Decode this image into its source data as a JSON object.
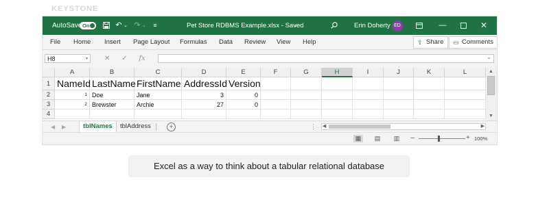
{
  "ghost_text": "KEYSTONE",
  "window": {
    "autosave_label": "AutoSave",
    "autosave_state": "On",
    "title": "Pet Store RDBMS Example.xlsx - Saved",
    "title_dropdown": "⌄",
    "user_name": "Erin Doherty",
    "user_initials": "ED",
    "accent_color": "#217346",
    "avatar_color": "#8a3ea8"
  },
  "menu": {
    "items": [
      "File",
      "Home",
      "Insert",
      "Page Layout",
      "Formulas",
      "Data",
      "Review",
      "View",
      "Help"
    ],
    "share_label": "Share",
    "comments_label": "Comments"
  },
  "formula": {
    "name_box": "H8",
    "value": ""
  },
  "columns": [
    "A",
    "B",
    "C",
    "D",
    "E",
    "F",
    "G",
    "H",
    "I",
    "J",
    "K",
    "L"
  ],
  "selected_column": "H",
  "rows": [
    {
      "n": "1",
      "a": "NameId",
      "b": "LastName",
      "c": "FirstName",
      "d": "AddressId",
      "e": "Version"
    },
    {
      "n": "2",
      "a": "1",
      "b": "Doe",
      "c": "Jane",
      "d": "3",
      "e": "0"
    },
    {
      "n": "3",
      "a": "2",
      "b": "Brewster",
      "c": "Archie",
      "d": "27",
      "e": "0"
    },
    {
      "n": "4",
      "a": "",
      "b": "",
      "c": "",
      "d": "",
      "e": ""
    }
  ],
  "sheets": [
    "tblNames",
    "tblAddress"
  ],
  "active_sheet": "tblNames",
  "status": {
    "zoom": "100%"
  },
  "caption": "Excel as a way to think about a tabular relational database"
}
